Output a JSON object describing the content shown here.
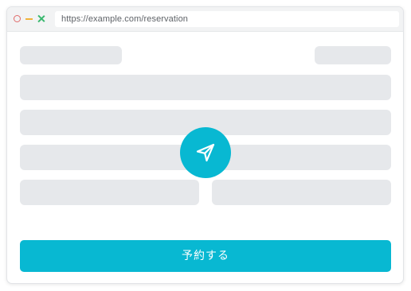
{
  "browser": {
    "url": "https://example.com/reservation",
    "controls": {
      "close_icon": "circle-outline",
      "minimize_icon": "dash",
      "maximize_icon": "cross"
    }
  },
  "form": {
    "placeholder_rows": 5,
    "send_icon": "paper-plane-icon",
    "submit_label": "予約する"
  },
  "colors": {
    "accent": "#08b8d2",
    "placeholder": "#e6e8eb",
    "titlebar": "#f2f3f4",
    "close": "#e06a6a",
    "minimize": "#f0b33a",
    "maximize": "#39b86e"
  }
}
